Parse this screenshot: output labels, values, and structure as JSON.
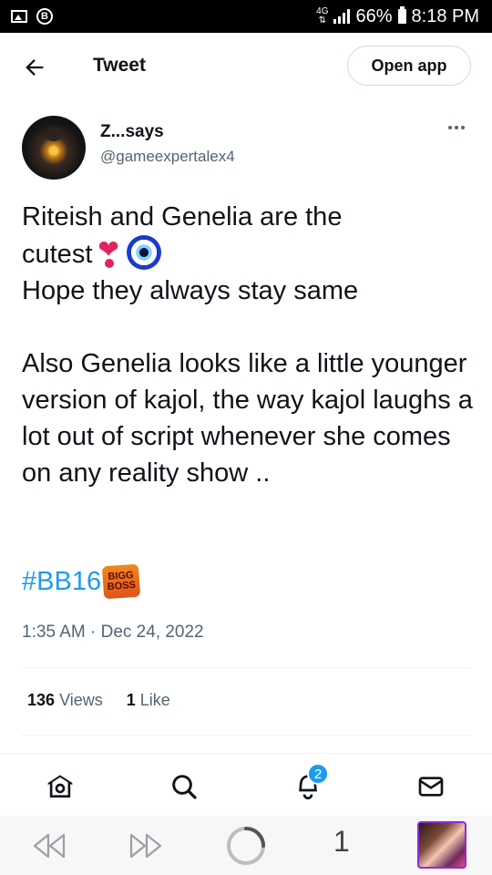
{
  "status_bar": {
    "network": "4G",
    "battery": "66%",
    "time": "8:18 PM"
  },
  "header": {
    "title": "Tweet",
    "open_app_label": "Open app"
  },
  "author": {
    "display_name": "Z...says",
    "handle": "@gameexpertalex4"
  },
  "tweet": {
    "line1_a": "Riteish and Genelia are the",
    "line1_b": "cutest",
    "line2": "Hope they always stay same",
    "paragraph2": "Also Genelia looks like a little younger version of kajol, the way kajol laughs a lot out of script whenever she comes on any reality show ..",
    "hashtag": "#BB16",
    "hashtag_emoji_text": [
      "BIGG",
      "BOSS"
    ],
    "timestamp": "1:35 AM · Dec 24, 2022"
  },
  "stats": {
    "views_count": "136",
    "views_label": "Views",
    "likes_count": "1",
    "likes_label": "Like"
  },
  "nav": {
    "notifications_badge": "2"
  },
  "browser_bar": {
    "tab_count": "1"
  },
  "colors": {
    "accent": "#1d9bf0",
    "text_secondary": "#536471"
  }
}
